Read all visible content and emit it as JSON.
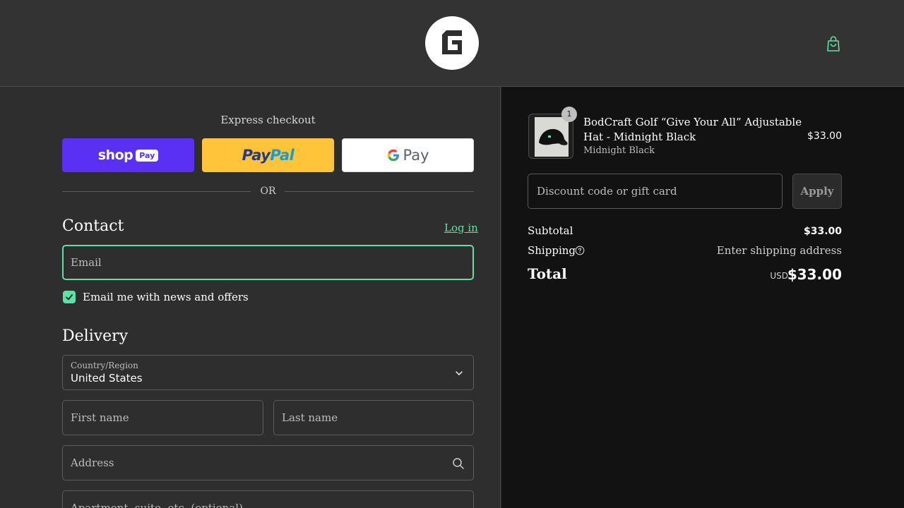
{
  "header": {
    "logo_name": "bodcraft-logo",
    "cart_icon": "shopping-bag-icon"
  },
  "checkout": {
    "express_title": "Express checkout",
    "shop_pay": {
      "word": "shop",
      "pill": "Pay"
    },
    "paypal": {
      "part1": "Pay",
      "part2": "Pal"
    },
    "google_pay": {
      "pay": "Pay"
    },
    "or_text": "OR",
    "contact": {
      "title": "Contact",
      "login_link": "Log in",
      "email_placeholder": "Email",
      "newsletter_label": "Email me with news and offers",
      "newsletter_checked": true
    },
    "delivery": {
      "title": "Delivery",
      "country_caption": "Country/Region",
      "country_value": "United States",
      "first_name_placeholder": "First name",
      "last_name_placeholder": "Last name",
      "address_placeholder": "Address",
      "apartment_placeholder": "Apartment, suite, etc. (optional)"
    }
  },
  "summary": {
    "item": {
      "quantity": "1",
      "name": "BodCraft Golf “Give Your All” Adjustable Hat - Midnight Black",
      "variant": "Midnight Black",
      "price": "$33.00"
    },
    "discount_placeholder": "Discount code or gift card",
    "apply_label": "Apply",
    "subtotal_label": "Subtotal",
    "subtotal_value": "$33.00",
    "shipping_label": "Shipping",
    "shipping_value": "Enter shipping address",
    "total_label": "Total",
    "total_currency": "USD",
    "total_value": "$33.00"
  },
  "colors": {
    "accent": "#5fe0a7",
    "shop_pay": "#5a31f4",
    "paypal": "#ffc439",
    "header_bg": "#333333",
    "summary_bg": "#121212"
  }
}
